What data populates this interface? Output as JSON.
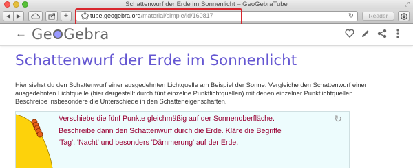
{
  "window": {
    "title": "Schattenwurf der Erde im Sonnenlicht – GeoGebraTube"
  },
  "browser": {
    "nav_back_icon": "triangle-left",
    "nav_forward_icon": "triangle-right",
    "address_domain": "tube.geogebra.org",
    "address_path": "/material/simple/id/160817",
    "reload_symbol": "↻",
    "reader_label": "Reader",
    "highlight_color": "#d8262d"
  },
  "app": {
    "back_symbol": "←",
    "logo_left": "Ge",
    "logo_right": "Gebra",
    "icons": [
      "heart-icon",
      "pencil-icon",
      "share-icon",
      "menu-icon"
    ],
    "accent_color": "#6557d2"
  },
  "page": {
    "title": "Schattenwurf der Erde im Sonnenlicht",
    "description": "Hier siehst du den Schattenwurf einer ausgedehnten Lichtquelle am Beispiel der Sonne. Vergleiche den Schattenwurf einer ausgedehnten Lichtquelle (hier dargestellt durch fünf einzelne Punktlichtquellen) mit denen einzelner Punktlichtquellen. Beschreibe insbesondere die Unterschiede in den Schatteneigenschaften."
  },
  "applet": {
    "instruction_line1": "Verschiebe die fünf Punkte gleichmäßig auf der Sonnenoberfläche.",
    "instruction_line2": "Beschreibe dann den Schattenwurf durch die Erde. Kläre die Begriffe",
    "instruction_line3": "'Tag', 'Nacht' und besonders 'Dämmerung' auf der Erde.",
    "refresh_symbol": "↻",
    "sun_color": "#fdd20b",
    "point_color": "#e8611a",
    "text_color": "#990033"
  }
}
